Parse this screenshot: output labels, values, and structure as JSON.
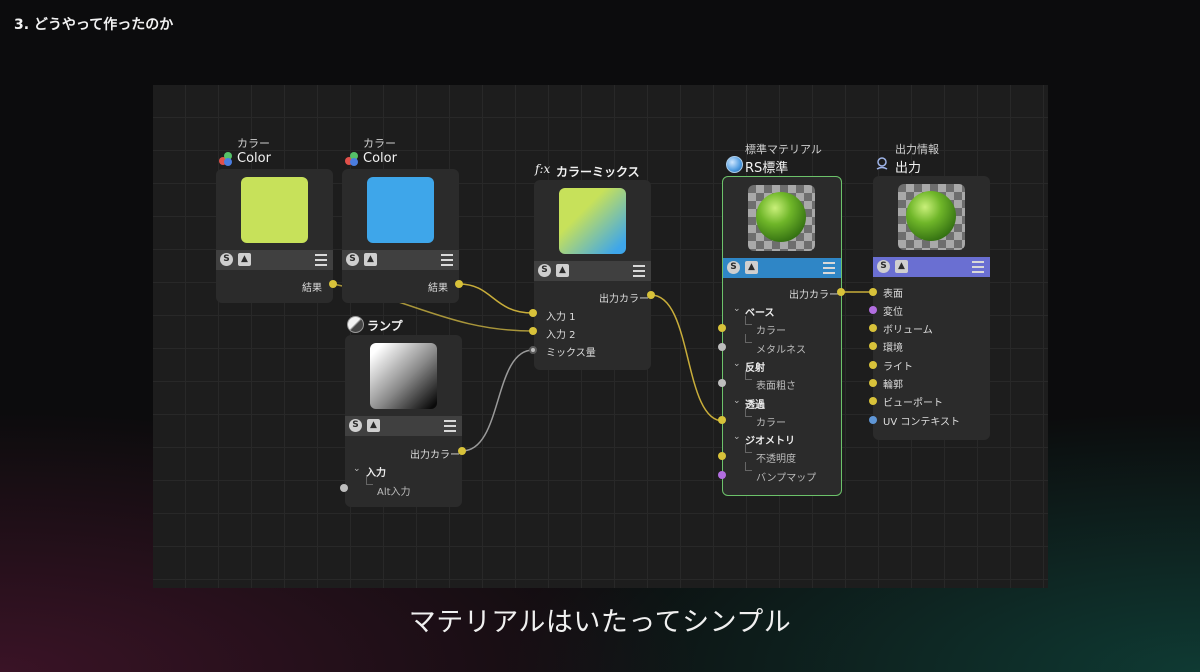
{
  "slide": {
    "title": "3. どうやって作ったのか",
    "caption": "マテリアルはいたってシンプル"
  },
  "nodes": {
    "color1": {
      "type_label": "カラー",
      "title": "Color",
      "swatch": "#c7e15a",
      "out_label": "結果"
    },
    "color2": {
      "type_label": "カラー",
      "title": "Color",
      "swatch": "#3ea6ea",
      "out_label": "結果"
    },
    "ramp": {
      "title": "ランプ",
      "out_label": "出力カラー",
      "group_label": "入力",
      "alt_label": "Alt入力"
    },
    "mix": {
      "title": "カラーミックス",
      "fx": "f:x",
      "out_label": "出力カラー",
      "inputs": [
        "入力 1",
        "入力 2",
        "ミックス量"
      ]
    },
    "standard": {
      "type_label": "標準マテリアル",
      "title": "RS標準",
      "bar_color": "#2f86c6",
      "out_label": "出力カラー",
      "sections": [
        {
          "label": "ベース",
          "items": [
            "カラー",
            "メタルネス"
          ]
        },
        {
          "label": "反射",
          "items": [
            "表面粗さ"
          ]
        },
        {
          "label": "透過",
          "items": [
            "カラー"
          ]
        },
        {
          "label": "ジオメトリ",
          "items": [
            "不透明度",
            "バンプマップ"
          ]
        }
      ]
    },
    "output": {
      "type_label": "出力情報",
      "title": "出力",
      "bar_color": "#6a6fd2",
      "inputs": [
        "表面",
        "変位",
        "ボリューム",
        "環境",
        "ライト",
        "輪郭",
        "ビューポート",
        "UV コンテキスト"
      ]
    }
  },
  "toolbar_icons": [
    "s-icon",
    "image-icon",
    "menu-icon"
  ],
  "colors": {
    "wire": "#c8ad3a",
    "wire_gray": "#9a9a9a",
    "selected_border": "#6cc26a",
    "port_yellow": "#d8c23a",
    "port_purple": "#b26ee0",
    "port_blue": "#5f96d6",
    "port_gray": "#bdbdbd"
  }
}
